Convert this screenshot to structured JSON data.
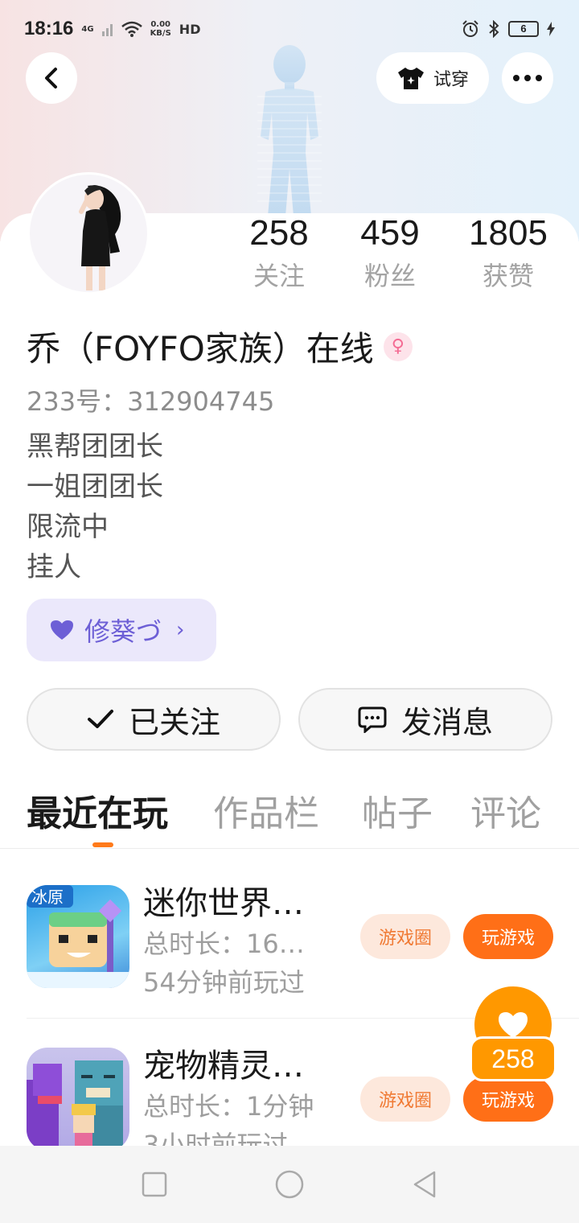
{
  "status_bar": {
    "time": "18:16",
    "network": "4G",
    "speed_top": "0.00",
    "speed_bottom": "KB/S",
    "hd": "HD",
    "battery": "6"
  },
  "header": {
    "tryon_label": "试穿"
  },
  "profile": {
    "name": "乔（FOYFO家族）在线",
    "uid": "233号：312904745",
    "bio": [
      "黑帮团团长",
      "一姐团团长",
      "限流中",
      "挂人"
    ],
    "guild": "修葵づ"
  },
  "stats": [
    {
      "num": "258",
      "label": "关注"
    },
    {
      "num": "459",
      "label": "粉丝"
    },
    {
      "num": "1805",
      "label": "获赞"
    }
  ],
  "actions": {
    "follow_label": "已关注",
    "message_label": "发消息"
  },
  "tabs": [
    "最近在玩",
    "作品栏",
    "帖子",
    "评论"
  ],
  "games": [
    {
      "title": "迷你世界…",
      "duration": "总时长：16…",
      "last_played": "54分钟前玩过",
      "circle_label": "游戏圈",
      "play_label": "玩游戏"
    },
    {
      "title": "宠物精灵…",
      "duration": "总时长：1分钟",
      "last_played": "3小时前玩过",
      "circle_label": "游戏圈",
      "play_label": "玩游戏"
    }
  ],
  "floating_like": {
    "count": "258"
  },
  "colors": {
    "accent_orange": "#ff6f17",
    "guild_purple": "#6d5fd6",
    "gender_pink": "#f46b93"
  }
}
